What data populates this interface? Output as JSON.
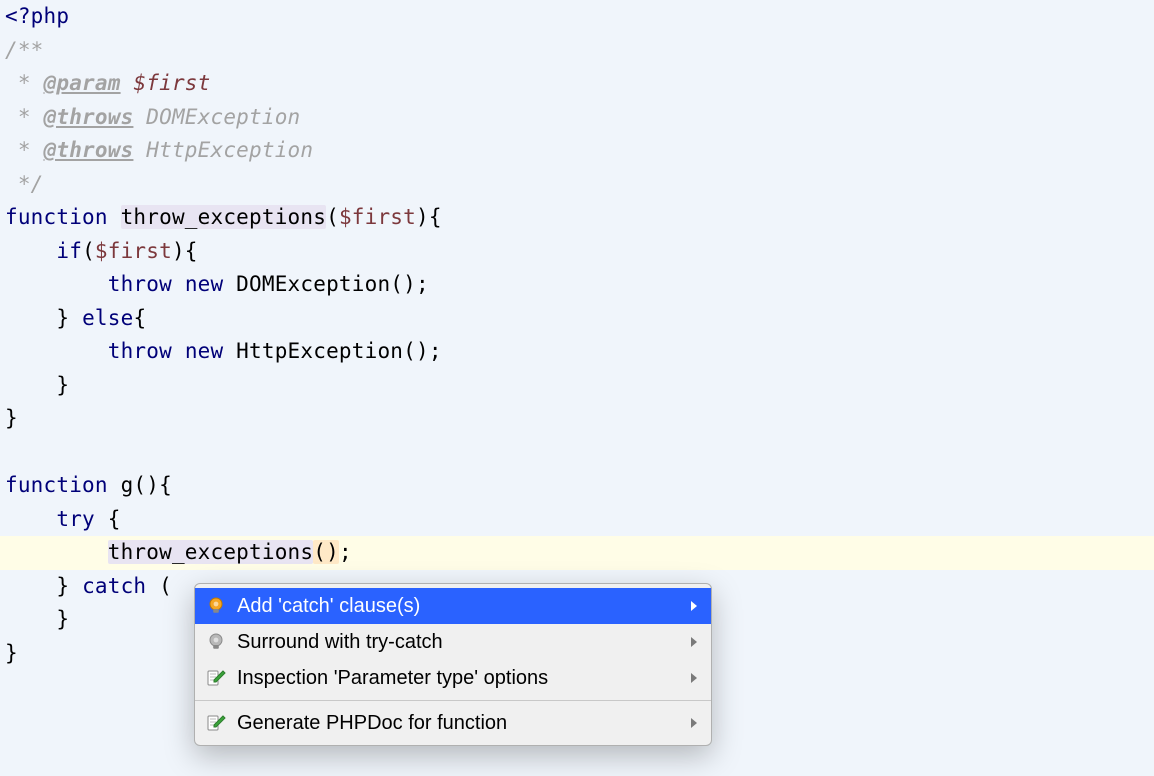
{
  "code": {
    "l1_phpopen": "<?php",
    "l2_doc_open": "/**",
    "l3_star": " * ",
    "l3_tag": "@param",
    "l3_sp": " ",
    "l3_var": "$first",
    "l4_star": " * ",
    "l4_tag": "@throws",
    "l4_rest": " DOMException",
    "l5_star": " * ",
    "l5_tag": "@throws",
    "l5_rest": " HttpException",
    "l6_doc_close": " */",
    "l7_fn": "function",
    "l7_sp1": " ",
    "l7_name": "throw_exceptions",
    "l7_open": "(",
    "l7_arg": "$first",
    "l7_close": "){",
    "l8_indent": "    ",
    "l8_if": "if",
    "l8_open": "(",
    "l8_var": "$first",
    "l8_close": "){",
    "l9_indent": "        ",
    "l9_throw": "throw",
    "l9_sp": " ",
    "l9_new": "new",
    "l9_rest": " DOMException();",
    "l10_indent": "    ",
    "l10_brace": "} ",
    "l10_else": "else",
    "l10_open": "{",
    "l11_indent": "        ",
    "l11_throw": "throw",
    "l11_sp": " ",
    "l11_new": "new",
    "l11_rest": " HttpException();",
    "l12_indent": "    ",
    "l12_brace": "}",
    "l13_brace": "}",
    "l14_blank": "",
    "l15_fn": "function",
    "l15_rest": " g(){",
    "l16_indent": "    ",
    "l16_try": "try",
    "l16_rest": " {",
    "l17_indent": "        ",
    "l17_call": "throw_exceptions",
    "l17_args": "()",
    "l17_semi": ";",
    "l18_indent": "    ",
    "l18_brace": "} ",
    "l18_catch": "catch",
    "l18_rest": " (",
    "l19_indent": "    ",
    "l19_brace": "}",
    "l20_brace": "}"
  },
  "menu": {
    "items": [
      {
        "label": "Add 'catch' clause(s)",
        "icon": "bulb-yellow",
        "submenu": true,
        "selected": true
      },
      {
        "label": "Surround with try-catch",
        "icon": "bulb-grey",
        "submenu": true,
        "selected": false
      },
      {
        "label": "Inspection 'Parameter type' options",
        "icon": "pencil",
        "submenu": true,
        "selected": false
      }
    ],
    "items2": [
      {
        "label": "Generate PHPDoc for function",
        "icon": "pencil",
        "submenu": true,
        "selected": false
      }
    ]
  }
}
